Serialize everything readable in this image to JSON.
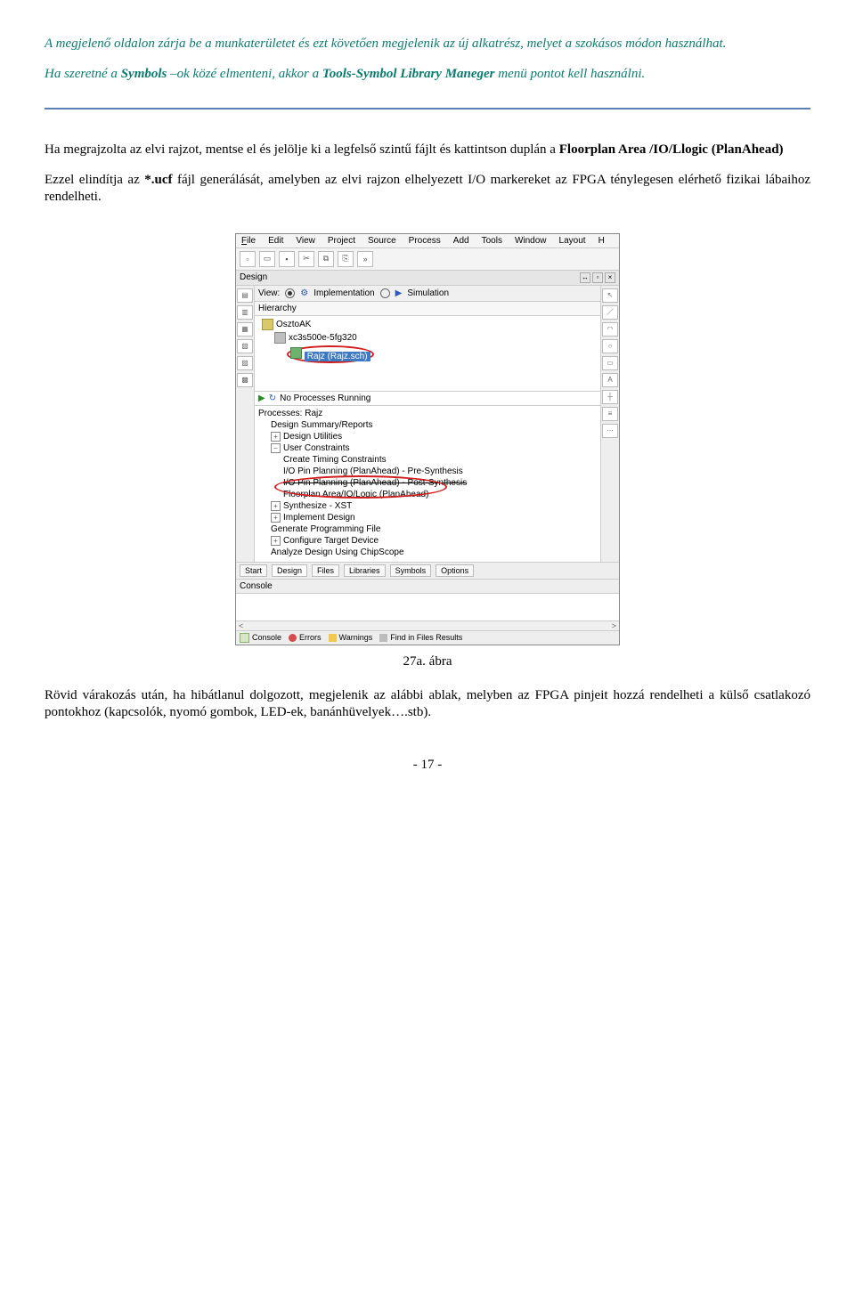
{
  "intro": {
    "p1a": "A megjelenő oldalon zárja be a munkaterületet és ezt követően megjelenik az új alkatrész, melyet a szokásos módon használhat.",
    "p2a": "Ha szeretné a ",
    "p2b": "Symbols",
    "p2c": " –ok közé elmenteni, akkor a ",
    "p2d": "Tools-Symbol Library Maneger",
    "p2e": " menü pontot kell használni."
  },
  "body": {
    "p3a": "Ha megrajzolta az elvi rajzot, mentse el és jelölje ki a legfelső szintű fájlt és kattintson duplán a ",
    "p3b": "Floorplan Area /IO/Llogic  (PlanAhead)",
    "p4a": "Ezzel elindítja az  ",
    "p4b": "*.ucf",
    "p4c": "  fájl generálását, amelyben az elvi rajzon elhelyezett I/O markereket az FPGA ténylegesen elérhető fizikai lábaihoz rendelheti."
  },
  "menubar": {
    "file": "File",
    "edit": "Edit",
    "view": "View",
    "project": "Project",
    "source": "Source",
    "process": "Process",
    "add": "Add",
    "tools": "Tools",
    "window": "Window",
    "layout": "Layout",
    "help": "H"
  },
  "design": {
    "panel_title": "Design",
    "view_label": "View:",
    "impl": "Implementation",
    "sim": "Simulation",
    "hierarchy": "Hierarchy",
    "proj": "OsztoAK",
    "chip": "xc3s500e-5fg320",
    "rajz": "Rajz (Rajz.sch)"
  },
  "processes": {
    "running": "No Processes Running",
    "header": "Processes: Rajz",
    "items": {
      "summary": "Design Summary/Reports",
      "utils": "Design Utilities",
      "userc": "User Constraints",
      "timing": "Create Timing Constraints",
      "iopre": "I/O Pin Planning (PlanAhead) - Pre-Synthesis",
      "iopost": "I/O Pin Planning (PlanAhead) - Post-Synthesis",
      "floor": "Floorplan Area/IO/Logic (PlanAhead)",
      "synth": "Synthesize - XST",
      "impl": "Implement Design",
      "gen": "Generate Programming File",
      "conf": "Configure Target Device",
      "analyze": "Analyze Design Using ChipScope"
    }
  },
  "tabs": {
    "start": "Start",
    "design": "Design",
    "files": "Files",
    "libraries": "Libraries",
    "symbols": "Symbols",
    "options": "Options"
  },
  "console": {
    "title": "Console",
    "tabs": {
      "console": "Console",
      "errors": "Errors",
      "warnings": "Warnings",
      "find": "Find in Files Results"
    }
  },
  "caption": "27a. ábra",
  "closing": "Rövid várakozás után, ha hibátlanul dolgozott, megjelenik az alábbi ablak, melyben az FPGA pinjeit hozzá rendelheti a külső csatlakozó pontokhoz (kapcsolók, nyomó gombok, LED-ek, banánhüvelyek….stb).",
  "page_num": "- 17 -"
}
